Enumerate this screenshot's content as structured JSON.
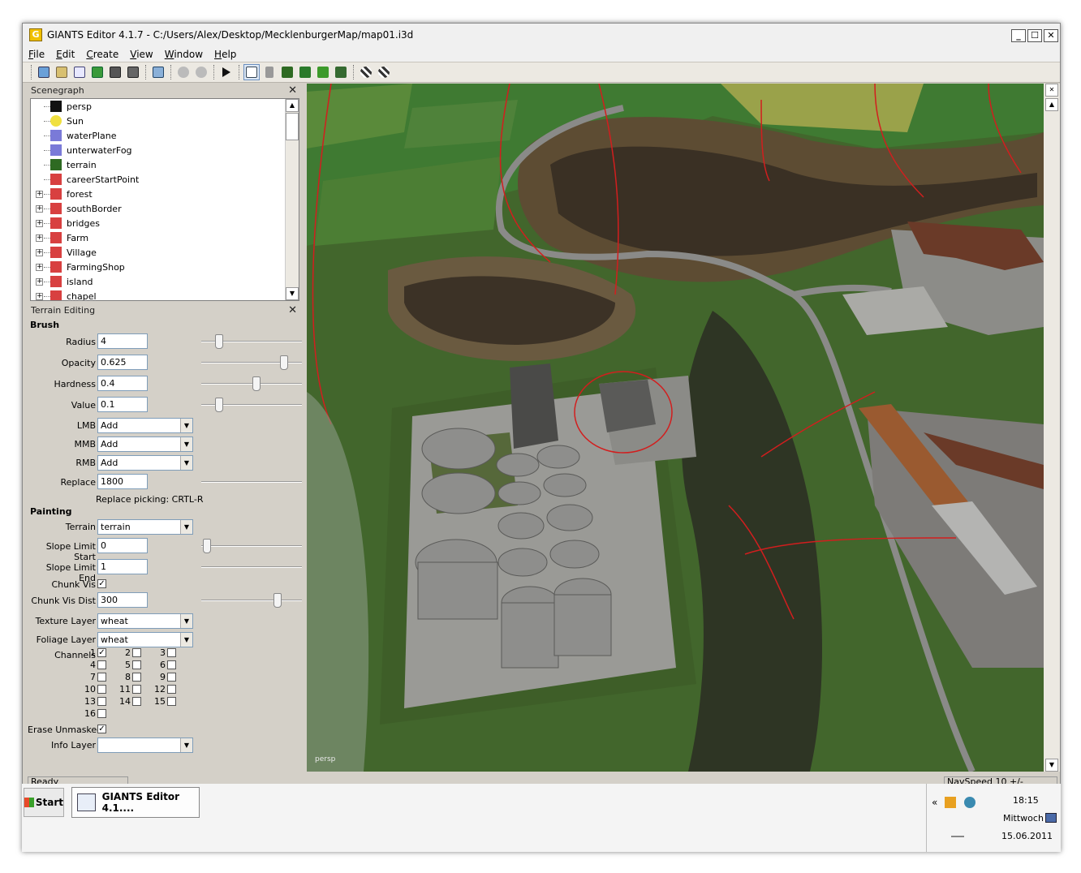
{
  "window": {
    "title": "GIANTS Editor 4.1.7 - C:/Users/Alex/Desktop/MecklenburgerMap/map01.i3d",
    "app_icon_letter": "G",
    "minimize": "_",
    "maximize": "☐",
    "close": "✕"
  },
  "menu": [
    {
      "first": "F",
      "rest": "ile"
    },
    {
      "first": "E",
      "rest": "dit"
    },
    {
      "first": "C",
      "rest": "reate"
    },
    {
      "first": "V",
      "rest": "iew"
    },
    {
      "first": "W",
      "rest": "indow"
    },
    {
      "first": "H",
      "rest": "elp"
    }
  ],
  "scenegraph": {
    "title": "Scenegraph",
    "close": "✕",
    "nodes": [
      {
        "label": "persp",
        "icon": "camera-icon",
        "expandable": false
      },
      {
        "label": "Sun",
        "icon": "light-bulb-icon",
        "expandable": false
      },
      {
        "label": "waterPlane",
        "icon": "cube-icon",
        "expandable": false
      },
      {
        "label": "unterwaterFog",
        "icon": "cube-icon",
        "expandable": false
      },
      {
        "label": "terrain",
        "icon": "terrain-icon",
        "expandable": false
      },
      {
        "label": "careerStartPoint",
        "icon": "transform-group-icon",
        "expandable": false
      },
      {
        "label": "forest",
        "icon": "transform-group-icon",
        "expandable": true
      },
      {
        "label": "southBorder",
        "icon": "transform-group-icon",
        "expandable": true
      },
      {
        "label": "bridges",
        "icon": "transform-group-icon",
        "expandable": true
      },
      {
        "label": "Farm",
        "icon": "transform-group-icon",
        "expandable": true
      },
      {
        "label": "Village",
        "icon": "transform-group-icon",
        "expandable": true
      },
      {
        "label": "FarmingShop",
        "icon": "transform-group-icon",
        "expandable": true
      },
      {
        "label": "island",
        "icon": "transform-group-icon",
        "expandable": true
      },
      {
        "label": "chapel",
        "icon": "transform-group-icon",
        "expandable": true
      }
    ]
  },
  "terrain_editing": {
    "title": "Terrain Editing",
    "close": "✕",
    "brush_title": "Brush",
    "radius_label": "Radius",
    "radius_value": "4",
    "opacity_label": "Opacity",
    "opacity_value": "0.625",
    "hardness_label": "Hardness",
    "hardness_value": "0.4",
    "value_label": "Value",
    "value_value": "0.1",
    "lmb_label": "LMB",
    "lmb_value": "Add",
    "mmb_label": "MMB",
    "mmb_value": "Add",
    "rmb_label": "RMB",
    "rmb_value": "Add",
    "replace_label": "Replace",
    "replace_value": "1800",
    "replace_picking": "Replace picking: CRTL-R",
    "painting_title": "Painting",
    "terrain_label": "Terrain",
    "terrain_value": "terrain",
    "slope_start_label": "Slope Limit Start",
    "slope_start_value": "0",
    "slope_end_label": "Slope Limit End",
    "slope_end_value": "1",
    "chunk_vis_label": "Chunk Vis",
    "chunk_vis_checked": true,
    "chunk_vis_dist_label": "Chunk Vis Dist",
    "chunk_vis_dist_value": "300",
    "texture_layer_label": "Texture Layer",
    "texture_layer_value": "wheat",
    "foliage_layer_label": "Foliage Layer",
    "foliage_layer_value": "wheat",
    "channels_label": "Channels",
    "channels": [
      {
        "n": "1",
        "checked": true
      },
      {
        "n": "2",
        "checked": false
      },
      {
        "n": "3",
        "checked": false
      },
      {
        "n": "4",
        "checked": false
      },
      {
        "n": "5",
        "checked": false
      },
      {
        "n": "6",
        "checked": false
      },
      {
        "n": "7",
        "checked": false
      },
      {
        "n": "8",
        "checked": false
      },
      {
        "n": "9",
        "checked": false
      },
      {
        "n": "10",
        "checked": false
      },
      {
        "n": "11",
        "checked": false
      },
      {
        "n": "12",
        "checked": false
      },
      {
        "n": "13",
        "checked": false
      },
      {
        "n": "14",
        "checked": false
      },
      {
        "n": "15",
        "checked": false
      },
      {
        "n": "16",
        "checked": false
      }
    ],
    "erase_unmasked_label": "Erase Unmasked",
    "erase_unmasked_checked": true,
    "info_layer_label": "Info Layer",
    "info_layer_value": "",
    "slider_levels": {
      "radius": 0.15,
      "opacity": 0.85,
      "hardness": 0.55,
      "value": 0.15,
      "replace": 0.0,
      "slope_start": 0.02,
      "slope_end": 0.0,
      "chunk_vis_dist": 0.78
    },
    "checkmark": "✓",
    "arrow": "▼"
  },
  "status": {
    "left": "Ready",
    "right": "NavSpeed 10 +/-"
  },
  "viewport": {
    "camera_label": "persp"
  },
  "taskbar": {
    "start_label": "Start",
    "task_label": "GIANTS Editor 4.1....",
    "time": "18:15",
    "day": "Mittwoch",
    "date": "15.06.2011",
    "tray_arrow": "«"
  },
  "colors": {
    "grass": "#4a6b2f",
    "soil": "#6b5a40",
    "road": "#8a8a88",
    "red_line": "#d21e1e"
  }
}
